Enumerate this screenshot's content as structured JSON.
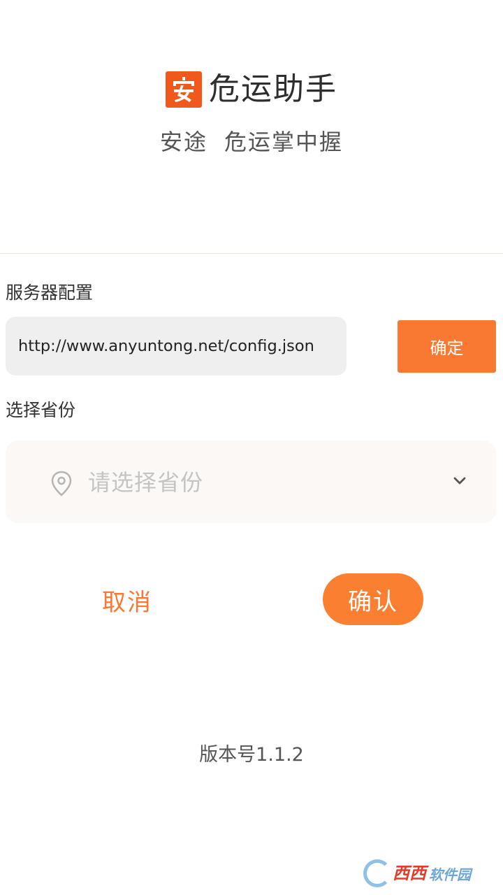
{
  "header": {
    "app_name": "危运助手",
    "logo_char": "安",
    "slogan_part1": "安途",
    "slogan_part2": "危运掌中握"
  },
  "server_config": {
    "label": "服务器配置",
    "url_value": "http://www.anyuntong.net/config.json",
    "confirm_label": "确定"
  },
  "province": {
    "label": "选择省份",
    "placeholder": "请选择省份",
    "icon": "location-pin-icon",
    "dropdown_icon": "chevron-down-icon"
  },
  "actions": {
    "cancel_label": "取消",
    "ok_label": "确认"
  },
  "footer": {
    "version": "版本号1.1.2"
  },
  "watermark": {
    "text": "西西",
    "text2": "软件园"
  },
  "colors": {
    "accent": "#f97932",
    "logo_bg": "#ef5a1c",
    "input_bg": "#efefef",
    "select_bg": "#fbf8f6"
  }
}
